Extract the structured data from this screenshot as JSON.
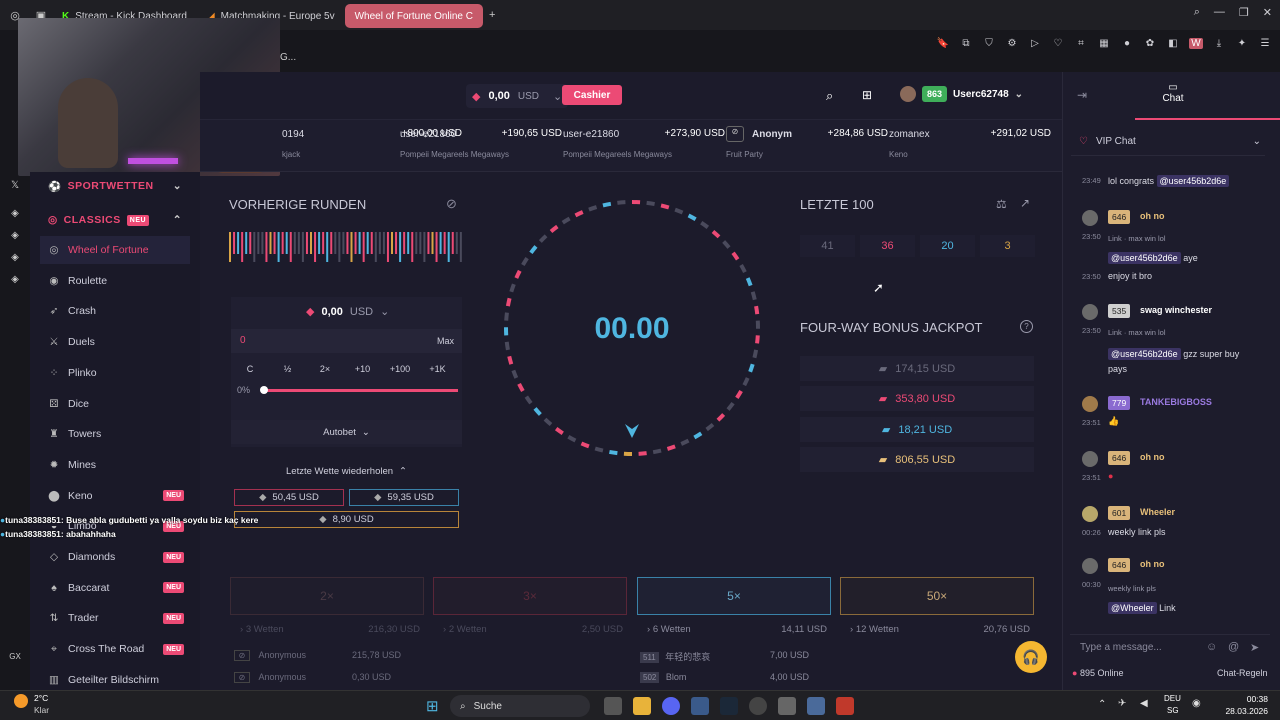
{
  "browser": {
    "tabs": [
      {
        "label": "Stream - Kick Dashboard"
      },
      {
        "label": "Matchmaking - Europe 5v"
      },
      {
        "label": "Wheel of Fortune Online C"
      }
    ],
    "address_text": "G..."
  },
  "header": {
    "balance_value": "0,00",
    "balance_currency": "USD",
    "cashier_label": "Cashier",
    "user_level": "863",
    "username": "Userc62748"
  },
  "ticker": [
    {
      "name": "0194",
      "amount": "+800,00 USD",
      "game": "kjack"
    },
    {
      "name": "user-e21860",
      "amount": "+190,65 USD",
      "game": "Pompeii Megareels Megaways"
    },
    {
      "name": "user-e21860",
      "amount": "+273,90 USD",
      "game": "Pompeii Megareels Megaways"
    },
    {
      "name": "Anonym",
      "amount": "+284,86 USD",
      "game": "Fruit Party"
    },
    {
      "name": "zomanex",
      "amount": "+291,02 USD",
      "game": "Keno"
    }
  ],
  "sidebar": {
    "sportwetten": "SPORTWETTEN",
    "classics": "CLASSICS",
    "classics_badge": "NEU",
    "items": [
      {
        "label": "Wheel of Fortune",
        "icon": "wheel-icon",
        "badge": ""
      },
      {
        "label": "Roulette",
        "icon": "roulette-icon",
        "badge": ""
      },
      {
        "label": "Crash",
        "icon": "rocket-icon",
        "badge": ""
      },
      {
        "label": "Duels",
        "icon": "duels-icon",
        "badge": ""
      },
      {
        "label": "Plinko",
        "icon": "plinko-icon",
        "badge": ""
      },
      {
        "label": "Dice",
        "icon": "dice-icon",
        "badge": ""
      },
      {
        "label": "Towers",
        "icon": "tower-icon",
        "badge": ""
      },
      {
        "label": "Mines",
        "icon": "mine-icon",
        "badge": ""
      },
      {
        "label": "Keno",
        "icon": "keno-icon",
        "badge": "NEU"
      },
      {
        "label": "Limbo",
        "icon": "limbo-icon",
        "badge": "NEU"
      },
      {
        "label": "Diamonds",
        "icon": "diamond-icon",
        "badge": "NEU"
      },
      {
        "label": "Baccarat",
        "icon": "cards-icon",
        "badge": "NEU"
      },
      {
        "label": "Trader",
        "icon": "trader-icon",
        "badge": "NEU"
      },
      {
        "label": "Cross The Road",
        "icon": "road-icon",
        "badge": "NEU"
      },
      {
        "label": "Geteilter Bildschirm",
        "icon": "split-icon",
        "badge": ""
      }
    ]
  },
  "game": {
    "prev_rounds_title": "VORHERIGE RUNDEN",
    "bet_value": "0,00",
    "bet_currency": "USD",
    "amount_input": "0",
    "max_label": "Max",
    "quick_buttons": [
      "C",
      "½",
      "2×",
      "+10",
      "+100",
      "+1K"
    ],
    "slider_label": "0%",
    "autobet_label": "Autobet",
    "repeat_label": "Letzte Wette wiederholen",
    "last_bets": [
      "50,45 USD",
      "59,35 USD",
      "8,90 USD"
    ],
    "timer": "00.00",
    "last100_title": "LETZTE 100",
    "last100": [
      "41",
      "36",
      "20",
      "3"
    ],
    "jackpot_title": "FOUR-WAY BONUS JACKPOT",
    "jackpots": [
      "174,15 USD",
      "353,80 USD",
      "18,21 USD",
      "806,55 USD"
    ],
    "multipliers": [
      "2×",
      "3×",
      "5×",
      "50×"
    ],
    "bet_summaries": [
      {
        "bets": "3 Wetten",
        "total": "216,30 USD"
      },
      {
        "bets": "2 Wetten",
        "total": "2,50 USD"
      },
      {
        "bets": "6 Wetten",
        "total": "14,11 USD"
      },
      {
        "bets": "12 Wetten",
        "total": "20,76 USD"
      }
    ],
    "bet_rows_col1": [
      {
        "name": "Anonymous",
        "amount": "215,78 USD"
      },
      {
        "name": "Anonymous",
        "amount": "0,30 USD"
      }
    ],
    "bet_rows_col3": [
      {
        "level": "511",
        "name": "年轻的悲哀",
        "amount": "7,00 USD"
      },
      {
        "level": "502",
        "name": "Blom",
        "amount": "4,00 USD"
      }
    ]
  },
  "chat": {
    "tab_label": "Chat",
    "vip_label": "VIP Chat",
    "messages": [
      {
        "time": "23:49",
        "text": "lol congrats",
        "mention": "@user456b2d6e"
      },
      {
        "level": "646",
        "name": "oh no",
        "time": "23:50",
        "reply": "Link · max win lol",
        "mention": "@user456b2d6e",
        "text": "aye"
      },
      {
        "time": "23:50",
        "text": "enjoy it bro"
      },
      {
        "level": "535",
        "name": "swag winchester",
        "time": "23:50",
        "reply": "Link · max win lol",
        "mention": "@user456b2d6e",
        "text": "gzz super buy pays"
      },
      {
        "level": "779",
        "name": "TANKEBIGBOSS",
        "time": "23:51",
        "text": "👍"
      },
      {
        "level": "646",
        "name": "oh no",
        "time": "23:51",
        "text": "●"
      },
      {
        "level": "601",
        "name": "Wheeler",
        "time": "00:26",
        "text": "weekly link pls"
      },
      {
        "level": "646",
        "name": "oh no",
        "time": "00:30",
        "reply": "weekly link pls",
        "mention": "@Wheeler",
        "text": "Link"
      }
    ],
    "input_placeholder": "Type a message...",
    "online": "895 Online",
    "rules": "Chat-Regeln"
  },
  "overlay_chat": [
    {
      "user": "tuna38383851",
      "text": ": Buse abla gudubetti ya valla soydu biz kaç kere"
    },
    {
      "user": "tuna38383851",
      "text": ": abahahhaha"
    }
  ],
  "taskbar": {
    "weather_temp": "2°C",
    "weather_desc": "Klar",
    "search_label": "Suche",
    "lang": "DEU",
    "region": "SG",
    "time": "00:38",
    "date": "28.03.2026"
  },
  "colors": {
    "accent": "#ec4a75",
    "blue": "#4fb6e0",
    "gold": "#d9a546",
    "bg": "#1c1b2b"
  }
}
